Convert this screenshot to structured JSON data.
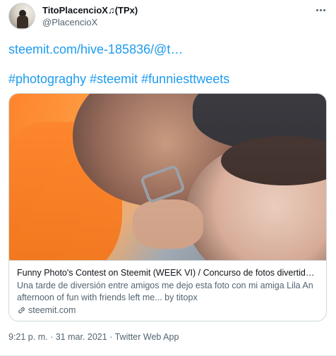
{
  "author": {
    "name": "TitoPlacencioX♫(TPx)",
    "handle": "@PlacencioX",
    "avatar_icon": "profile-photo"
  },
  "tweet": {
    "link_text": "steemit.com/hive-185836/@t…",
    "hashtags": [
      "#photograghy",
      "#steemit",
      "#funniesttweets"
    ]
  },
  "card": {
    "title": "Funny Photo's Contest on Steemit (WEEK VI) / Concurso de fotos divertidas en S...",
    "description": "Una tarde de diversión entre amigos me dejo esta foto con mi amiga Lila An afternoon of fun with friends left me... by titopx",
    "site": "steemit.com",
    "site_icon": "link-icon"
  },
  "footer": {
    "time": "9:21 p. m.",
    "separator": "·",
    "date": "31 mar. 2021",
    "source": "Twitter Web App"
  },
  "colors": {
    "link": "#1d9bf0",
    "secondary_text": "#536471",
    "border": "#cfd9de"
  }
}
